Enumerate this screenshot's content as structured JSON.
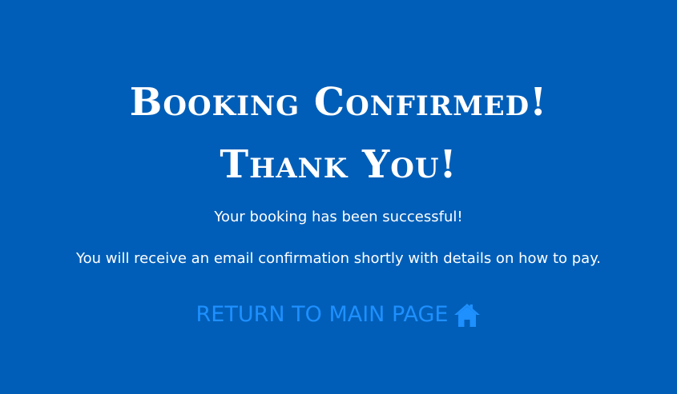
{
  "main": {
    "title_line1": "Booking Confirmed!",
    "title_line2": "Thank You!",
    "message_success": "Your booking has been successful!",
    "message_email": "You will receive an email confirmation shortly with details on how to pay.",
    "return_link": {
      "label": "RETURN TO MAIN PAGE",
      "icon": "home-icon"
    }
  },
  "colors": {
    "background": "#005eb8",
    "text": "#ffffff",
    "link": "#1e90ff"
  }
}
